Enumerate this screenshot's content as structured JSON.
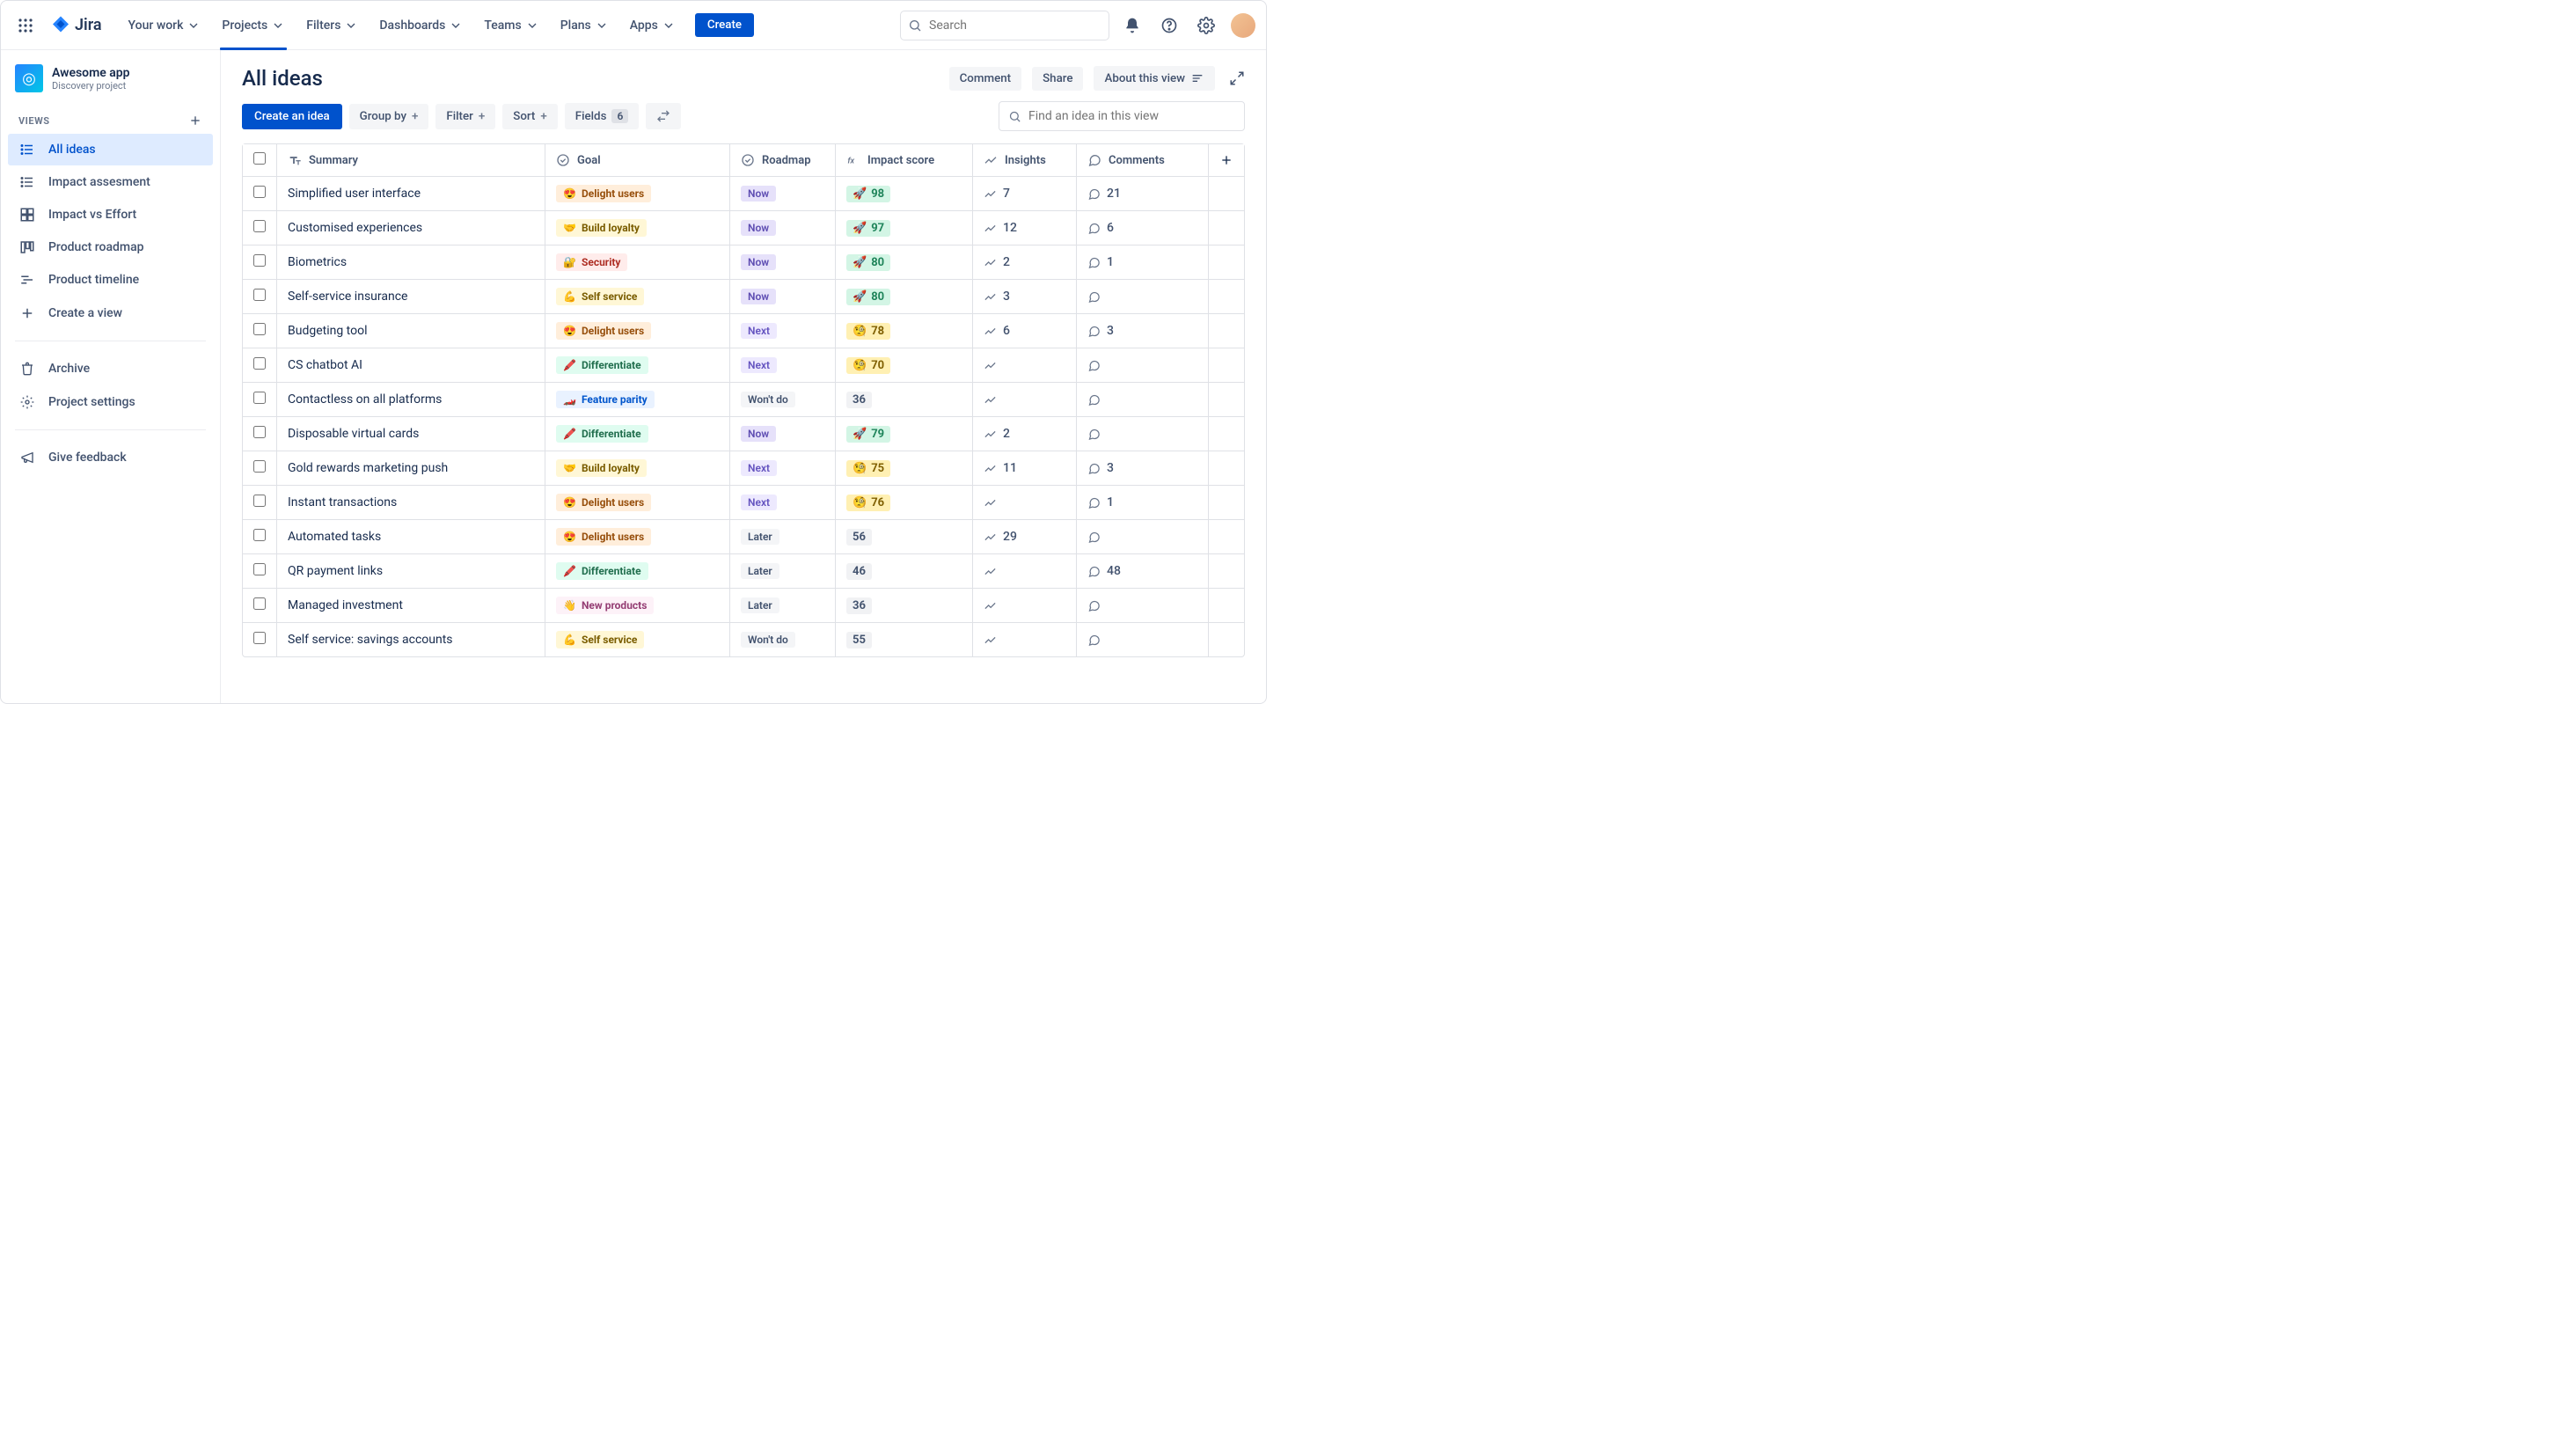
{
  "nav": {
    "logo": "Jira",
    "items": [
      "Your work",
      "Projects",
      "Filters",
      "Dashboards",
      "Teams",
      "Plans",
      "Apps"
    ],
    "active_index": 1,
    "create": "Create",
    "search_placeholder": "Search"
  },
  "sidebar": {
    "project_name": "Awesome app",
    "project_subtitle": "Discovery project",
    "views_label": "VIEWS",
    "views": [
      {
        "label": "All ideas",
        "icon": "list",
        "selected": true
      },
      {
        "label": "Impact assesment",
        "icon": "list"
      },
      {
        "label": "Impact vs Effort",
        "icon": "matrix"
      },
      {
        "label": "Product roadmap",
        "icon": "board"
      },
      {
        "label": "Product timeline",
        "icon": "timeline"
      }
    ],
    "create_view": "Create a view",
    "archive": "Archive",
    "project_settings": "Project settings",
    "give_feedback": "Give feedback"
  },
  "header": {
    "title": "All ideas",
    "comment": "Comment",
    "share": "Share",
    "about": "About this view"
  },
  "toolbar": {
    "create_idea": "Create an idea",
    "group_by": "Group by",
    "filter": "Filter",
    "sort": "Sort",
    "fields": "Fields",
    "fields_count": "6",
    "search_placeholder": "Find an idea in this view"
  },
  "columns": {
    "summary": "Summary",
    "goal": "Goal",
    "roadmap": "Roadmap",
    "impact": "Impact score",
    "insights": "Insights",
    "comments": "Comments"
  },
  "goal_styles": {
    "Delight users": {
      "cls": "goal-delight",
      "emoji": "😍"
    },
    "Build loyalty": {
      "cls": "goal-loyalty",
      "emoji": "🤝"
    },
    "Security": {
      "cls": "goal-security",
      "emoji": "🔐"
    },
    "Self service": {
      "cls": "goal-selfservice",
      "emoji": "💪"
    },
    "Differentiate": {
      "cls": "goal-differentiate",
      "emoji": "🖍️"
    },
    "Feature parity": {
      "cls": "goal-featureparity",
      "emoji": "🏎️"
    },
    "New products": {
      "cls": "goal-newproducts",
      "emoji": "👋"
    }
  },
  "roadmap_styles": {
    "Now": "now",
    "Next": "next",
    "Later": "later",
    "Won't do": "wontdo"
  },
  "rows": [
    {
      "summary": "Simplified user interface",
      "goal": "Delight users",
      "roadmap": "Now",
      "impact": 98,
      "impact_style": "green",
      "impact_emoji": "🚀",
      "insights": 7,
      "comments": 21
    },
    {
      "summary": "Customised experiences",
      "goal": "Build loyalty",
      "roadmap": "Now",
      "impact": 97,
      "impact_style": "green",
      "impact_emoji": "🚀",
      "insights": 12,
      "comments": 6
    },
    {
      "summary": "Biometrics",
      "goal": "Security",
      "roadmap": "Now",
      "impact": 80,
      "impact_style": "green",
      "impact_emoji": "🚀",
      "insights": 2,
      "comments": 1
    },
    {
      "summary": "Self-service insurance",
      "goal": "Self service",
      "roadmap": "Now",
      "impact": 80,
      "impact_style": "green",
      "impact_emoji": "🚀",
      "insights": 3,
      "comments": null
    },
    {
      "summary": "Budgeting tool",
      "goal": "Delight users",
      "roadmap": "Next",
      "impact": 78,
      "impact_style": "yellow",
      "impact_emoji": "🧐",
      "insights": 6,
      "comments": 3
    },
    {
      "summary": "CS chatbot AI",
      "goal": "Differentiate",
      "roadmap": "Next",
      "impact": 70,
      "impact_style": "yellow",
      "impact_emoji": "🧐",
      "insights": null,
      "comments": null
    },
    {
      "summary": "Contactless on all platforms",
      "goal": "Feature parity",
      "roadmap": "Won't do",
      "impact": 36,
      "impact_style": "grey",
      "impact_emoji": null,
      "insights": null,
      "comments": null
    },
    {
      "summary": "Disposable virtual cards",
      "goal": "Differentiate",
      "roadmap": "Now",
      "impact": 79,
      "impact_style": "green",
      "impact_emoji": "🚀",
      "insights": 2,
      "comments": null
    },
    {
      "summary": "Gold rewards marketing push",
      "goal": "Build loyalty",
      "roadmap": "Next",
      "impact": 75,
      "impact_style": "yellow",
      "impact_emoji": "🧐",
      "insights": 11,
      "comments": 3
    },
    {
      "summary": "Instant transactions",
      "goal": "Delight users",
      "roadmap": "Next",
      "impact": 76,
      "impact_style": "yellow",
      "impact_emoji": "🧐",
      "insights": null,
      "comments": 1
    },
    {
      "summary": "Automated tasks",
      "goal": "Delight users",
      "roadmap": "Later",
      "impact": 56,
      "impact_style": "grey",
      "impact_emoji": null,
      "insights": 29,
      "comments": null
    },
    {
      "summary": "QR payment links",
      "goal": "Differentiate",
      "roadmap": "Later",
      "impact": 46,
      "impact_style": "grey",
      "impact_emoji": null,
      "insights": null,
      "comments": 48
    },
    {
      "summary": "Managed investment",
      "goal": "New products",
      "roadmap": "Later",
      "impact": 36,
      "impact_style": "grey",
      "impact_emoji": null,
      "insights": null,
      "comments": null
    },
    {
      "summary": "Self service: savings accounts",
      "goal": "Self service",
      "roadmap": "Won't do",
      "impact": 55,
      "impact_style": "grey",
      "impact_emoji": null,
      "insights": null,
      "comments": null
    }
  ]
}
